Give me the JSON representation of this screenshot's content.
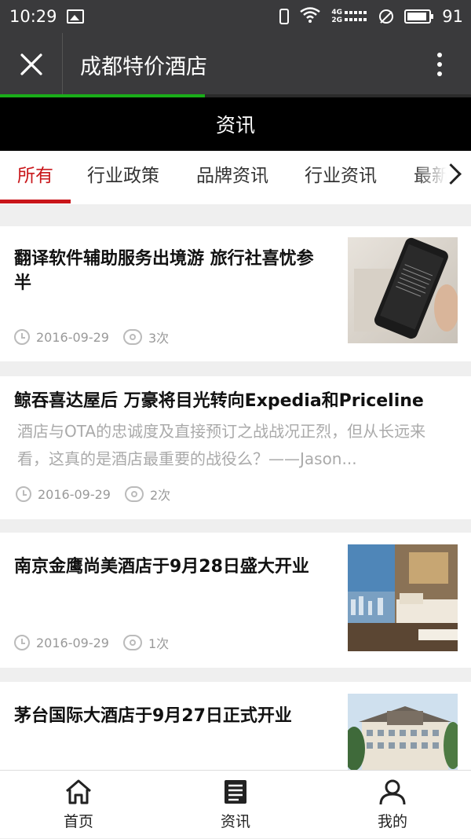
{
  "status_bar": {
    "time": "10:29",
    "network_4g": "4G",
    "network_2g": "2G",
    "battery": "91"
  },
  "titlebar": {
    "title": "成都特价酒店",
    "progress": 0.435
  },
  "page_header": "资讯",
  "tabs": [
    {
      "label": "所有",
      "active": true
    },
    {
      "label": "行业政策",
      "active": false
    },
    {
      "label": "品牌资讯",
      "active": false
    },
    {
      "label": "行业资讯",
      "active": false
    },
    {
      "label": "最新",
      "active": false
    }
  ],
  "articles": [
    {
      "title": "翻译软件辅助服务出境游 旅行社喜忧参半",
      "date": "2016-09-29",
      "views": "3次"
    },
    {
      "title": "鲸吞喜达屋后 万豪将目光转向Expedia和Priceline",
      "summary": "酒店与OTA的忠诚度及直接预订之战战况正烈，但从长远来看，这真的是酒店最重要的战役么？——Jason...",
      "date": "2016-09-29",
      "views": "2次"
    },
    {
      "title": "南京金鹰尚美酒店于9月28日盛大开业",
      "date": "2016-09-29",
      "views": "1次"
    },
    {
      "title": "茅台国际大酒店于9月27日正式开业"
    }
  ],
  "bottom_nav": [
    {
      "label": "首页",
      "icon": "home-icon"
    },
    {
      "label": "资讯",
      "icon": "news-icon"
    },
    {
      "label": "我的",
      "icon": "user-icon"
    }
  ],
  "colors": {
    "accent": "#c9161a",
    "progress": "#1aad19",
    "titlebar": "#3a3a3c"
  }
}
